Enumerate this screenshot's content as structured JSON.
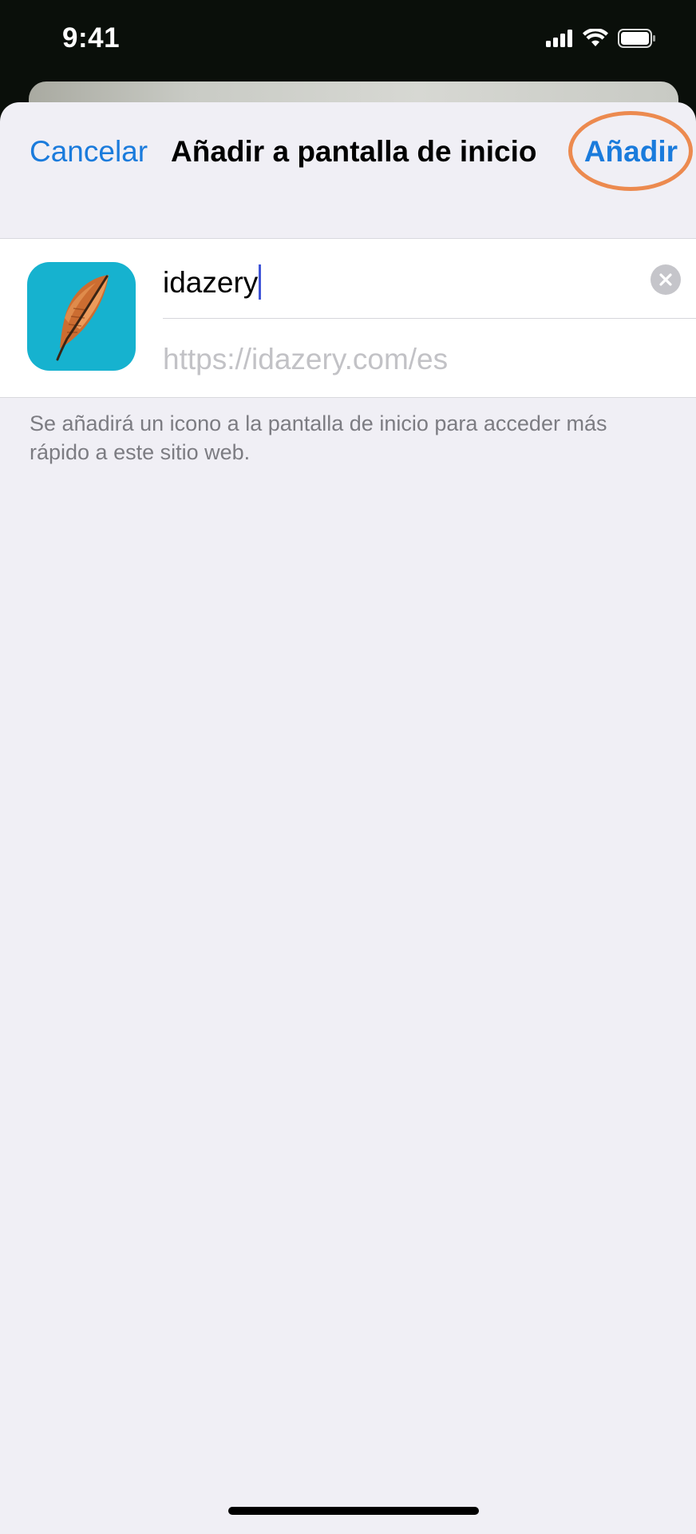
{
  "status_bar": {
    "time": "9:41",
    "icons": [
      "cellular-signal-icon",
      "wifi-icon",
      "battery-icon"
    ]
  },
  "nav": {
    "cancel_label": "Cancelar",
    "title": "Añadir a pantalla de inicio",
    "add_label": "Añadir"
  },
  "form": {
    "app_icon": "feather-icon",
    "name_value": "idazery",
    "url_value": "https://idazery.com/es",
    "clear_icon": "clear-icon"
  },
  "footnote": "Se añadirá un icono a la pantalla de inicio para acceder más rápido a este sitio web.",
  "colors": {
    "accent": "#1a7bdc",
    "highlight": "#ec8a4f",
    "icon_bg": "#16b2cf",
    "sheet_bg": "#f0eff5"
  }
}
